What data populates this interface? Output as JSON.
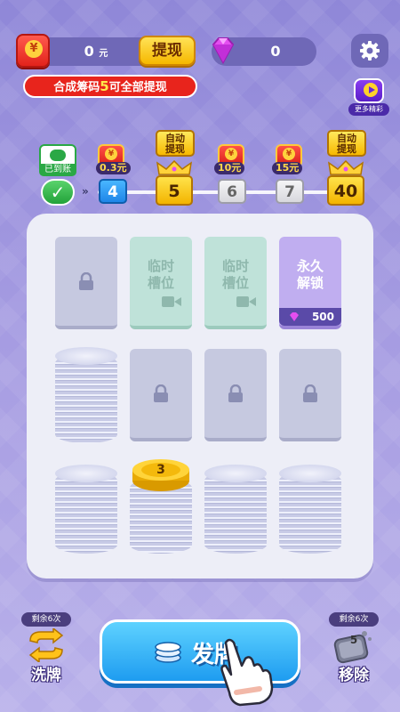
{
  "top_bar": {
    "cash_value": "0",
    "cash_unit": "元",
    "withdraw_label": "提现",
    "gem_value": "0",
    "hint_prefix": "合成筹码",
    "hint_highlight": "5",
    "hint_suffix": "可全部提现",
    "more_label": "更多精彩"
  },
  "progress": {
    "arrived_label": "已到账",
    "chevron": "»",
    "milestones": [
      {
        "value": "4",
        "reward": ""
      },
      {
        "value": "5",
        "reward": "",
        "tag": "自动提现"
      },
      {
        "value": "6",
        "reward": "10元"
      },
      {
        "value": "7",
        "reward": "15元"
      },
      {
        "value": "40",
        "reward": "",
        "tag": "自动提现"
      }
    ],
    "first_reward": "0.3元",
    "tag_line1": "自动",
    "tag_line2": "提现"
  },
  "board": {
    "temp_slot_line1": "临时",
    "temp_slot_line2": "槽位",
    "perm_slot_line1": "永久",
    "perm_slot_line2": "解锁",
    "perm_cost": "500",
    "gold_chip_number": "3"
  },
  "controls": {
    "shuffle_remaining": "剩余6次",
    "shuffle_label": "洗牌",
    "remove_remaining": "剩余6次",
    "remove_label": "移除",
    "remove_count": "5",
    "deal_label": "发牌"
  },
  "colors": {
    "background": "#a79de2",
    "accent_gold": "#f6b800",
    "accent_red": "#e8241c",
    "deal_blue": "#1e9cf0"
  }
}
